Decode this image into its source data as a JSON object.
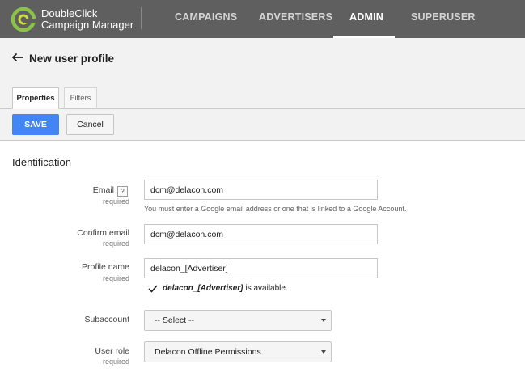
{
  "nav": {
    "brand_line1": "DoubleClick",
    "brand_line2": "Campaign Manager",
    "items": [
      {
        "label": "CAMPAIGNS",
        "active": false
      },
      {
        "label": "ADVERTISERS",
        "active": false
      },
      {
        "label": "ADMIN",
        "active": true
      },
      {
        "label": "SUPERUSER",
        "active": false
      }
    ]
  },
  "header": {
    "back_icon": "back-arrow-icon",
    "title": "New user profile",
    "tabs": [
      {
        "label": "Properties",
        "active": true
      },
      {
        "label": "Filters",
        "active": false
      }
    ]
  },
  "toolbar": {
    "save_label": "SAVE",
    "cancel_label": "Cancel"
  },
  "form": {
    "section_title": "Identification",
    "email": {
      "label": "Email",
      "help": "?",
      "required": "required",
      "value": "dcm@delacon.com",
      "hint": "You must enter a Google email address or one that is linked to a Google Account."
    },
    "confirm_email": {
      "label": "Confirm email",
      "required": "required",
      "value": "dcm@delacon.com"
    },
    "profile_name": {
      "label": "Profile name",
      "required": "required",
      "value": "delacon_[Advertiser]",
      "availability_name": "delacon_[Advertiser]",
      "availability_text": "is available."
    },
    "subaccount": {
      "label": "Subaccount",
      "selected": "-- Select --"
    },
    "user_role": {
      "label": "User role",
      "required": "required",
      "selected": "Delacon Offline Permissions"
    }
  },
  "colors": {
    "topbar": "#5f5f5f",
    "accent": "#4285f4",
    "logo_green": "#8bc34a"
  }
}
